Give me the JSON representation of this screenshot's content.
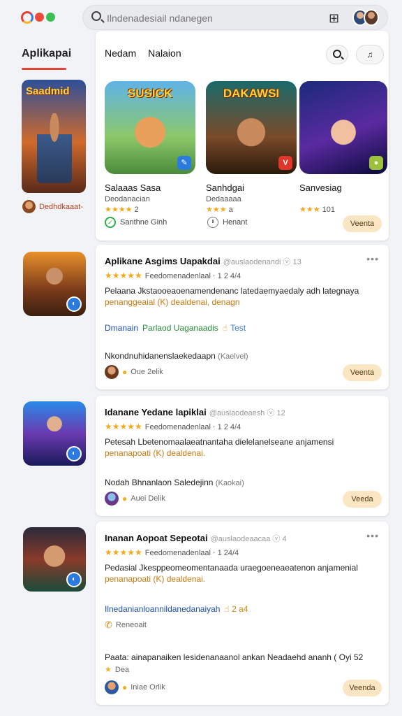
{
  "header": {
    "search_placeholder": "Ilndenadesiail ndanegen",
    "grid_icon": "grid-icon"
  },
  "sidebar": {
    "title": "Aplikapai",
    "thumb_title": "Saadmid",
    "author": "Dedhdkaaat-"
  },
  "featured": {
    "tabs": [
      "Nedam",
      "Nalaion"
    ],
    "music_label": "♫",
    "items": [
      {
        "art_title": "SUSICK",
        "name": "Salaaas Sasa",
        "sub": "Deodanacian",
        "stars": "★★★★",
        "rating": "2"
      },
      {
        "art_title": "DAKAWSI",
        "name": "Sanhdgai",
        "sub": "Dedaaaaa",
        "stars": "★★★",
        "rating": "a"
      },
      {
        "art_title": "",
        "name": "Sanvesiag",
        "sub": "",
        "stars": "★★★",
        "rating": "101"
      }
    ],
    "footer_left": "Santhne Ginh",
    "footer_mid": "Henant",
    "button": "Veenta"
  },
  "rows": [
    {
      "title": "Aplikane Asgims Uapakdai",
      "title_meta": "@auslaodenandi ⓥ 13",
      "rating_text": "Feedomenadenlaal ⋅ 1 2 4/4",
      "desc": "Pelaana Jkstaooeaoenamendenanc latedaemyaedaly adh lategnaya",
      "desc_hl": "penanggeaial (K) dealdenai, denagn",
      "tags": [
        "Dmanain",
        "Parlaod Uaganaadis",
        "☝",
        "Test"
      ],
      "meta": "Nkondnuhidanenslaekedaapn",
      "meta_small": "(Kaelvel)",
      "author": "Oue 2elik",
      "button": "Veenta"
    },
    {
      "title": "Idanane Yedane lapiklai",
      "title_meta": "@auslaodeaesh ⓥ 12",
      "rating_text": "Feedomenadenlaal ⋅ 1 2 4/4",
      "desc": "Petesah Lbetenomaalaeatnantaha dielelanelseane anjamensi",
      "desc_hl": "penanapoati (K) dealdenai.",
      "meta": "Nodah Bhnanlaon Saledejinn",
      "meta_small": "(Kaokai)",
      "author": "Auei Delik",
      "button": "Veeda"
    },
    {
      "title": "Inanan Aopoat Sepeotai",
      "title_meta": "@auslaodeaacaa ⓥ 4",
      "rating_text": "Feedomenadenlaal ⋅ 1 24/4",
      "desc": "Pedasial Jkesppeomeomentanaada uraegoeneaeatenon anjamenial",
      "desc_hl": "penanapoati (K) dealdenai.",
      "tag_line": "Ilnedanianloannildanedanaiyah",
      "tag_extra": "☝ 2 a4",
      "clock_label": "Reneoait",
      "long_line": "Paata: ainapanaiken lesidenanaanol ankan Neadaehd ananh ( Oyi 52",
      "long_author": "Dea",
      "author": "Iniae Orlik",
      "button": "Veenda"
    }
  ]
}
